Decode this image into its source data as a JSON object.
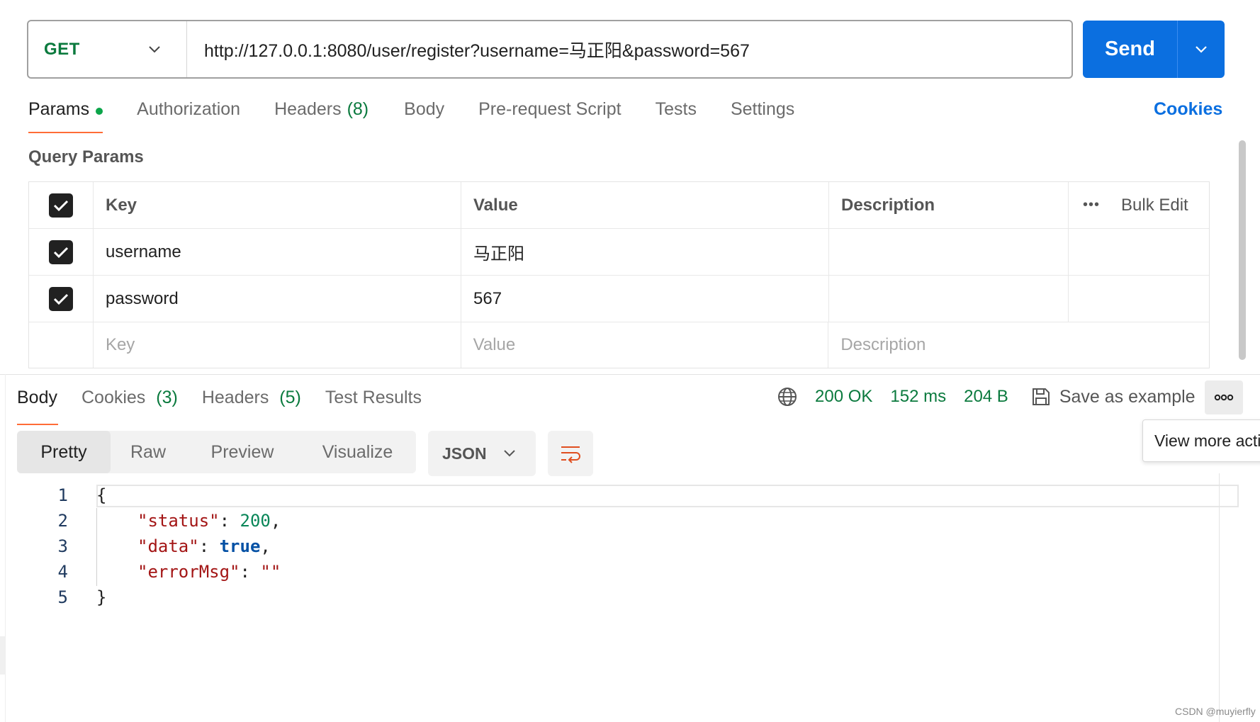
{
  "request": {
    "method": "GET",
    "url": "http://127.0.0.1:8080/user/register?username=马正阳&password=567",
    "send_label": "Send"
  },
  "request_tabs": [
    {
      "label": "Params",
      "active": true,
      "has_dot": true
    },
    {
      "label": "Authorization"
    },
    {
      "label": "Headers",
      "count": "(8)"
    },
    {
      "label": "Body"
    },
    {
      "label": "Pre-request Script"
    },
    {
      "label": "Tests"
    },
    {
      "label": "Settings"
    }
  ],
  "cookies_link": "Cookies",
  "query_params": {
    "title": "Query Params",
    "headers": {
      "key": "Key",
      "value": "Value",
      "description": "Description",
      "bulk_edit": "Bulk Edit"
    },
    "rows": [
      {
        "checked": true,
        "key": "username",
        "value": "马正阳",
        "description": ""
      },
      {
        "checked": true,
        "key": "password",
        "value": "567",
        "description": ""
      }
    ],
    "placeholders": {
      "key": "Key",
      "value": "Value",
      "description": "Description"
    }
  },
  "response_tabs": [
    {
      "label": "Body",
      "active": true
    },
    {
      "label": "Cookies",
      "count": "(3)"
    },
    {
      "label": "Headers",
      "count": "(5)"
    },
    {
      "label": "Test Results"
    }
  ],
  "response_status": {
    "status": "200 OK",
    "time": "152 ms",
    "size": "204 B",
    "save_example": "Save as example"
  },
  "tooltip": "View more actions",
  "view_modes": [
    "Pretty",
    "Raw",
    "Preview",
    "Visualize"
  ],
  "active_view_mode": "Pretty",
  "format": "JSON",
  "code_lines": [
    {
      "num": "1",
      "text": "{"
    },
    {
      "num": "2",
      "key": "\"status\"",
      "sep": ": ",
      "value": "200",
      "vtype": "number",
      "tail": ","
    },
    {
      "num": "3",
      "key": "\"data\"",
      "sep": ": ",
      "value": "true",
      "vtype": "bool",
      "tail": ","
    },
    {
      "num": "4",
      "key": "\"errorMsg\"",
      "sep": ": ",
      "value": "\"\"",
      "vtype": "string",
      "tail": ""
    },
    {
      "num": "5",
      "text": "}"
    }
  ],
  "watermark": "CSDN @muyierfly",
  "colors": {
    "method_green": "#0b7a3e",
    "send_blue": "#0b6fe0",
    "active_tab_underline": "#ff6c37",
    "status_green": "#0b7a3e",
    "json_key": "#a31515",
    "json_number": "#098658",
    "json_bool": "#0451a5"
  }
}
